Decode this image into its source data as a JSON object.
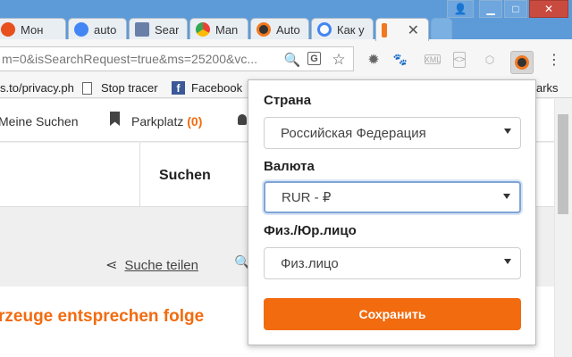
{
  "tabs": [
    {
      "label": "Мон",
      "favicon_color": "#e8501e"
    },
    {
      "label": "auto",
      "favicon_color": "#4285f4"
    },
    {
      "label": "Sear",
      "favicon_color": "#6a7fa8"
    },
    {
      "label": "Man",
      "favicon_color": "#34a853"
    },
    {
      "label": "Auto",
      "favicon_color": "#f2781f"
    },
    {
      "label": "Как у",
      "favicon_color": "#4285f4"
    }
  ],
  "omnibox": {
    "url": "m=0&isSearchRequest=true&ms=25200&vc..."
  },
  "bookmarks": {
    "privacy": "s.to/privacy.ph",
    "stop_tracer": "Stop tracer",
    "facebook": "Facebook",
    "other": "arks"
  },
  "page": {
    "nav_meine_suchen": "Meine Suchen",
    "nav_parkplatz": "Parkplatz",
    "nav_parkplatz_count": "(0)",
    "suchen": "Suchen",
    "suche_teilen": "Suche teilen",
    "result_headline": "rzeuge entsprechen folge"
  },
  "popup": {
    "country_label": "Страна",
    "country_value": "Российская Федерация",
    "currency_label": "Валюта",
    "currency_value": "RUR - ₽",
    "entity_label": "Физ./Юр.лицо",
    "entity_value": "Физ.лицо",
    "save_label": "Сохранить"
  },
  "colors": {
    "accent": "#f26b0f",
    "chrome_frame": "#5c9bd8"
  }
}
